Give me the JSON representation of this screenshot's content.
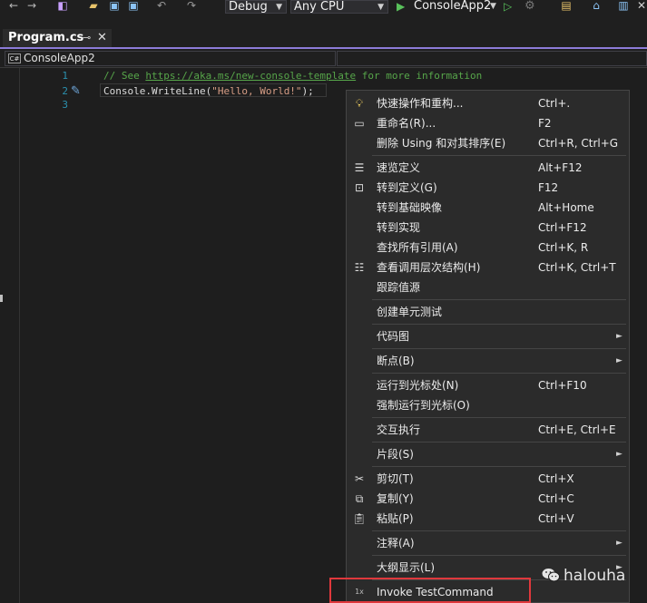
{
  "toolbar": {
    "config": "Debug",
    "platform": "Any CPU",
    "start_target": "ConsoleApp2",
    "play_icon": "play-triangle",
    "play_color": "#59c25b"
  },
  "tab": {
    "title": "Program.cs",
    "pin": "⊸",
    "close": "✕"
  },
  "navbar": {
    "project": "ConsoleApp2",
    "project_icon": "C#"
  },
  "editor": {
    "line_numbers": [
      "1",
      "2",
      "3"
    ],
    "line1_comment": "// See ",
    "line1_link": "https://aka.ms/new-console-template",
    "line1_tail": " for more information",
    "line2_code": "Console.WriteLine(",
    "line2_string": "\"Hello, World!\"",
    "line2_end": ");"
  },
  "context_menu": {
    "items": [
      {
        "label": "快速操作和重构...",
        "shortcut": "Ctrl+.",
        "icon": "lightbulb-icon"
      },
      {
        "label": "重命名(R)...",
        "shortcut": "F2",
        "icon": "rename-icon"
      },
      {
        "label": "删除 Using 和对其排序(E)",
        "shortcut": "Ctrl+R, Ctrl+G",
        "icon": ""
      },
      {
        "label": "速览定义",
        "shortcut": "Alt+F12",
        "icon": "peek-icon"
      },
      {
        "label": "转到定义(G)",
        "shortcut": "F12",
        "icon": "goto-definition-icon"
      },
      {
        "label": "转到基础映像",
        "shortcut": "Alt+Home",
        "icon": ""
      },
      {
        "label": "转到实现",
        "shortcut": "Ctrl+F12",
        "icon": ""
      },
      {
        "label": "查找所有引用(A)",
        "shortcut": "Ctrl+K, R",
        "icon": ""
      },
      {
        "label": "查看调用层次结构(H)",
        "shortcut": "Ctrl+K, Ctrl+T",
        "icon": "call-hierarchy-icon"
      },
      {
        "label": "跟踪值源",
        "shortcut": "",
        "icon": ""
      },
      {
        "label": "创建单元测试",
        "shortcut": "",
        "icon": ""
      },
      {
        "label": "代码图",
        "shortcut": "",
        "icon": ""
      },
      {
        "label": "断点(B)",
        "shortcut": "",
        "icon": ""
      },
      {
        "label": "运行到光标处(N)",
        "shortcut": "Ctrl+F10",
        "icon": ""
      },
      {
        "label": "强制运行到光标(O)",
        "shortcut": "",
        "icon": ""
      },
      {
        "label": "交互执行",
        "shortcut": "Ctrl+E, Ctrl+E",
        "icon": ""
      },
      {
        "label": "片段(S)",
        "shortcut": "",
        "icon": ""
      },
      {
        "label": "剪切(T)",
        "shortcut": "Ctrl+X",
        "icon": "scissors-icon"
      },
      {
        "label": "复制(Y)",
        "shortcut": "Ctrl+C",
        "icon": "copy-icon"
      },
      {
        "label": "粘贴(P)",
        "shortcut": "Ctrl+V",
        "icon": "paste-icon"
      },
      {
        "label": "注释(A)",
        "shortcut": "",
        "icon": ""
      },
      {
        "label": "大纲显示(L)",
        "shortcut": "",
        "icon": ""
      },
      {
        "label": "Invoke TestCommand",
        "shortcut": "",
        "icon": "1x-icon",
        "icon_text": "1x"
      }
    ],
    "submenu_arrow": "►"
  },
  "highlight_color": "#e0383c",
  "watermark": {
    "text": "halouha",
    "icon": "wechat-icon"
  }
}
